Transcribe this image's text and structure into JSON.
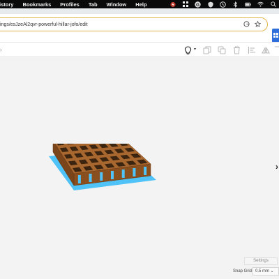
{
  "menubar": {
    "items": [
      "istory",
      "Bookmarks",
      "Profiles",
      "Tab",
      "Window",
      "Help"
    ]
  },
  "browser": {
    "url": "ings/esJzeAl2qvr-powerful-hillar-jofo/edit"
  },
  "canvas": {
    "settings_label": "Settings",
    "snap_grid_label": "Snap Grid",
    "snap_grid_value": "0.5 mm ⌄"
  },
  "colors": {
    "menubar_bg": "#0a0a0a",
    "url_focus_ring": "#e3b64b",
    "extension_blue": "#2e6fdb",
    "model_wood": "#a8672e",
    "workplane_blue": "#4fc3f7"
  },
  "icons": {
    "toolbar": [
      "lightbulb-icon",
      "copy-icon",
      "duplicate-icon",
      "delete-icon",
      "align-icon",
      "mirror-icon",
      "flip-icon"
    ]
  }
}
